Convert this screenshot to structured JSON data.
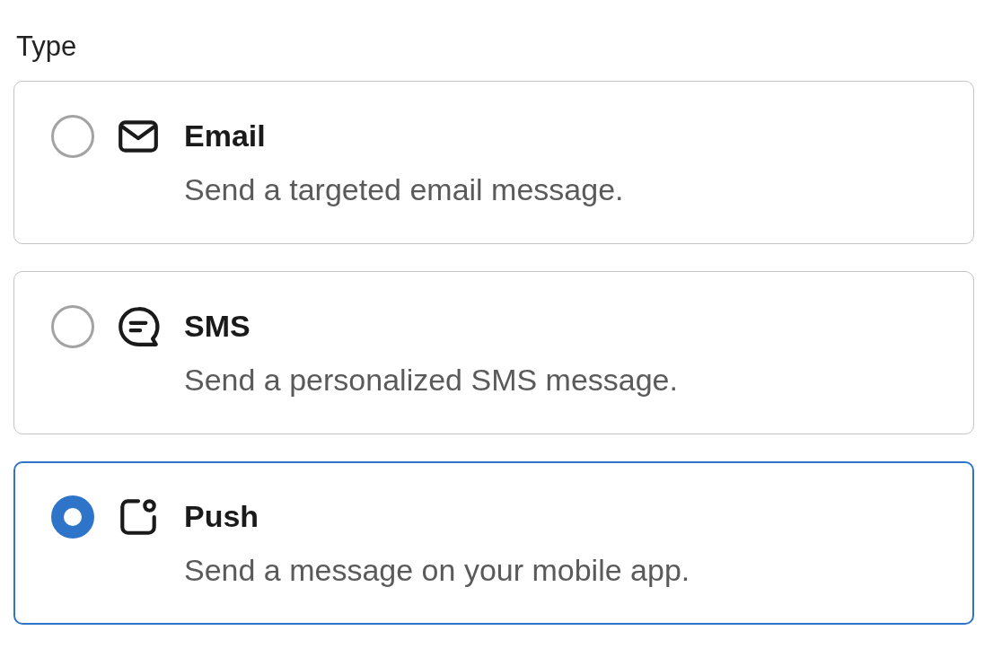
{
  "label": "Type",
  "options": [
    {
      "kind": "email",
      "title": "Email",
      "description": "Send a targeted email message.",
      "selected": false
    },
    {
      "kind": "sms",
      "title": "SMS",
      "description": "Send a personalized SMS message.",
      "selected": false
    },
    {
      "kind": "push",
      "title": "Push",
      "description": "Send a message on your mobile app.",
      "selected": true
    }
  ]
}
